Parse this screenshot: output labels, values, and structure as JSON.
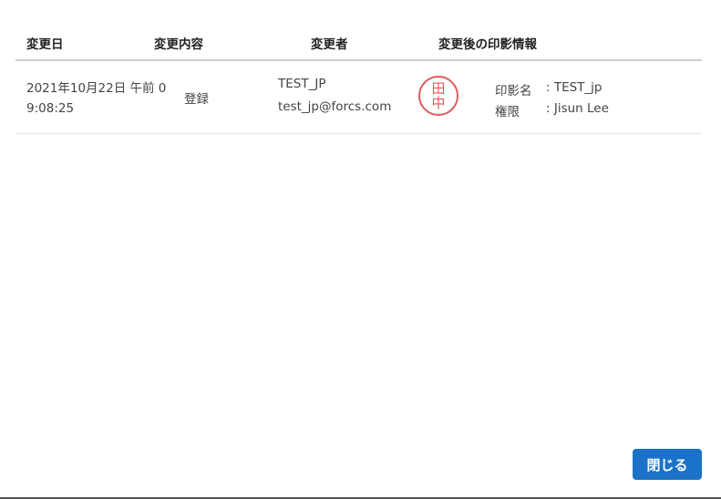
{
  "table": {
    "headers": {
      "date": "変更日",
      "change": "変更内容",
      "changer": "変更者",
      "seal_info": "変更後の印影情報"
    },
    "rows": [
      {
        "date": "2021年10月22日 午前 09:08:25",
        "action": "登録",
        "user_name": "TEST_JP",
        "user_email": "test_jp@forcs.com",
        "seal_chars": [
          "田",
          "中"
        ],
        "seal_name_label": "印影名",
        "seal_name_value": ": TEST_jp",
        "permission_label": "権限",
        "permission_value": ": Jisun Lee"
      }
    ]
  },
  "footer": {
    "close_label": "閉じる"
  },
  "colors": {
    "accent": "#1a73c8",
    "seal": "#e05a5a"
  },
  "icons": {
    "seal": "seal-stamp-icon"
  }
}
